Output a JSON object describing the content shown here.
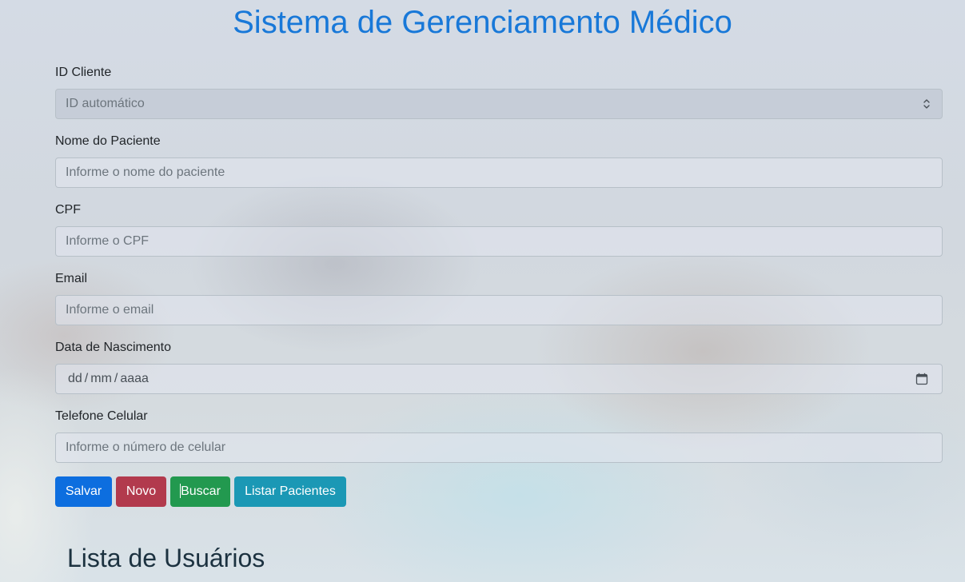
{
  "page": {
    "title": "Sistema de Gerenciamento Médico",
    "list_title": "Lista de Usuários"
  },
  "form": {
    "id_cliente": {
      "label": "ID Cliente",
      "selected": "ID automático"
    },
    "nome": {
      "label": "Nome do Paciente",
      "placeholder": "Informe o nome do paciente"
    },
    "cpf": {
      "label": "CPF",
      "placeholder": "Informe o CPF"
    },
    "email": {
      "label": "Email",
      "placeholder": "Informe o email"
    },
    "nascimento": {
      "label": "Data de Nascimento",
      "day": "dd",
      "month": "mm",
      "year": "aaaa",
      "separator": "/"
    },
    "celular": {
      "label": "Telefone Celular",
      "placeholder": "Informe o número de celular"
    }
  },
  "buttons": {
    "save": "Salvar",
    "new": "Novo",
    "search": "Buscar",
    "list": "Listar Pacientes"
  },
  "colors": {
    "title": "#1878d8",
    "primary": "#0d6edf",
    "danger": "#b23a4d",
    "success": "#22994f",
    "info": "#1b98b5"
  },
  "icons": {
    "select": "chevron-up-down-icon",
    "date": "calendar-icon"
  }
}
